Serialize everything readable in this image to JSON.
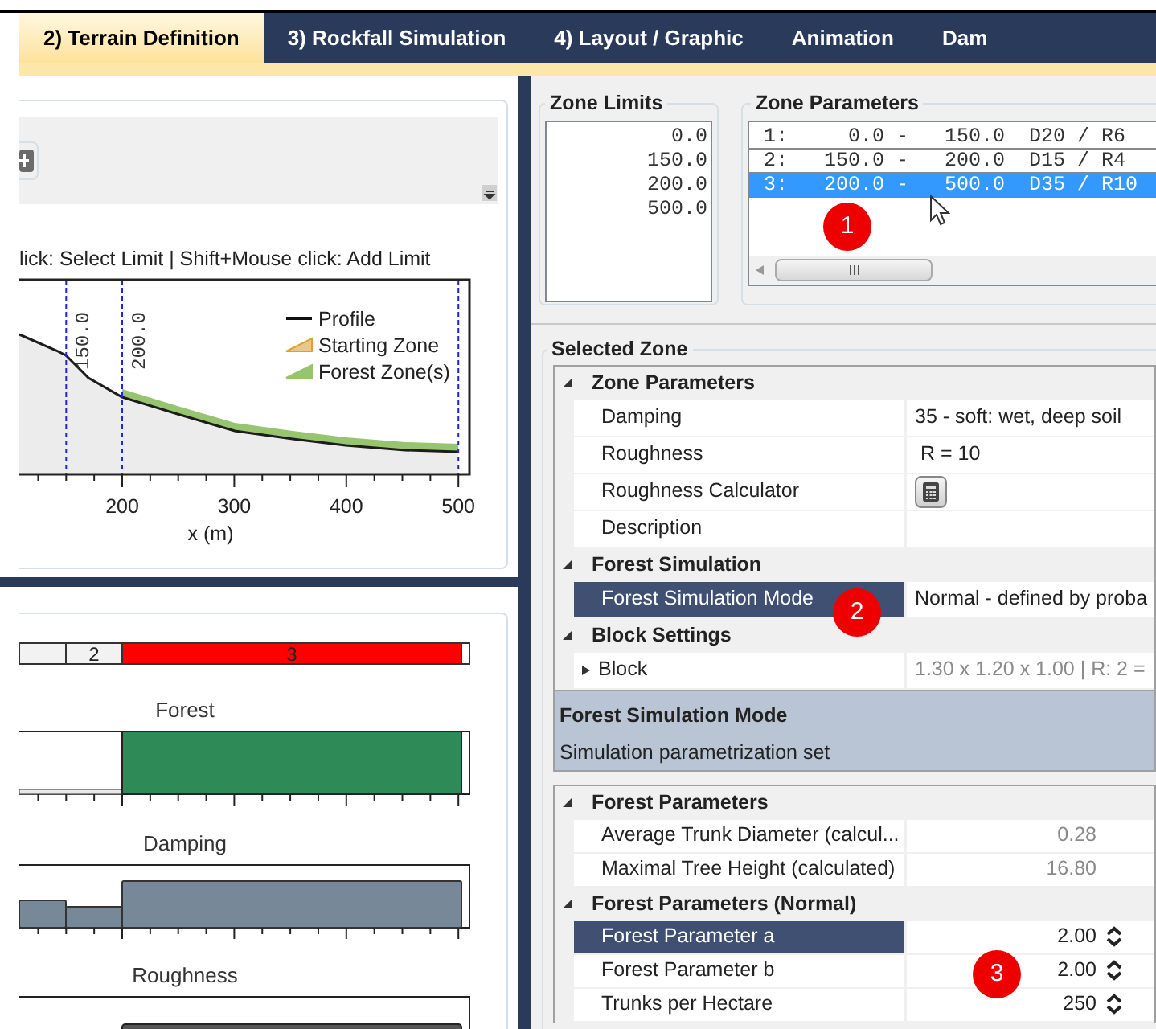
{
  "tabs": [
    {
      "label": "2) Terrain Definition",
      "selected": true
    },
    {
      "label": "3) Rockfall Simulation",
      "selected": false
    },
    {
      "label": "4) Layout / Graphic",
      "selected": false
    },
    {
      "label": "Animation",
      "selected": false
    },
    {
      "label": "Dam",
      "selected": false
    }
  ],
  "profile_chart": {
    "hint": "lick: Select Limit | Shift+Mouse click: Add Limit",
    "limit_labels": [
      "150.0",
      "200.0"
    ],
    "x_ticks": [
      "200",
      "300",
      "400",
      "500"
    ],
    "x_label": "x (m)",
    "legend": [
      {
        "label": "Profile",
        "kind": "line"
      },
      {
        "label": "Starting Zone",
        "kind": "start"
      },
      {
        "label": "Forest Zone(s)",
        "kind": "forest"
      }
    ]
  },
  "zone_strip": [
    {
      "label": "2",
      "selected": false
    },
    {
      "label": "3",
      "selected": true
    }
  ],
  "forest_chart": {
    "title": "Forest"
  },
  "damping_chart": {
    "title": "Damping"
  },
  "roughness_chart": {
    "title": "Roughness"
  },
  "zone_limits": {
    "title": "Zone Limits",
    "values": [
      "0.0",
      "150.0",
      "200.0",
      "500.0"
    ]
  },
  "zone_parameters": {
    "title": "Zone Parameters",
    "rows": [
      {
        "text": "1:     0.0 -   150.0  D20 / R6",
        "selected": false
      },
      {
        "text": "2:   150.0 -   200.0  D15 / R4",
        "selected": false
      },
      {
        "text": "3:   200.0 -   500.0  D35 / R10",
        "selected": true
      }
    ]
  },
  "selected_zone": {
    "title": "Selected Zone",
    "categories": [
      {
        "label": "Zone Parameters",
        "expanded": true,
        "properties": [
          {
            "name": "Damping",
            "kind": "text",
            "value": "35 - soft: wet, deep soil",
            "selected": false,
            "readonly": false
          },
          {
            "name": "Roughness",
            "kind": "text",
            "value": " R = 10",
            "selected": false,
            "readonly": false
          },
          {
            "name": "Roughness Calculator",
            "kind": "button",
            "selected": false
          },
          {
            "name": "Description",
            "kind": "text",
            "selected": false
          }
        ]
      },
      {
        "label": "Forest Simulation",
        "expanded": true,
        "properties": [
          {
            "name": "Forest Simulation Mode",
            "kind": "text",
            "value": "Normal - defined by proba",
            "selected": true,
            "readonly": false
          }
        ]
      },
      {
        "label": "Block Settings",
        "expanded": true,
        "properties": [
          {
            "name": "Block",
            "kind": "text",
            "value": "1.30 x 1.20 x 1.00 | R: 2 =",
            "selected": false,
            "readonly": true,
            "expanded": false
          }
        ]
      }
    ],
    "description": {
      "title": "Forest Simulation Mode",
      "text": "Simulation parametrization set"
    }
  },
  "forest_grid": {
    "categories": [
      {
        "label": "Forest Parameters",
        "expanded": true,
        "properties": [
          {
            "name": "Average Trunk Diameter (calcul...",
            "kind": "number",
            "value": "0.28",
            "selected": false,
            "readonly": true
          },
          {
            "name": "Maximal Tree Height (calculated)",
            "kind": "number",
            "value": "16.80",
            "selected": false,
            "readonly": true
          }
        ]
      },
      {
        "label": "Forest Parameters (Normal)",
        "expanded": true,
        "properties": [
          {
            "name": "Forest Parameter a",
            "kind": "spinner",
            "value": "2.00",
            "selected": true,
            "readonly": false
          },
          {
            "name": "Forest Parameter b",
            "kind": "spinner",
            "value": "2.00",
            "selected": false,
            "readonly": false
          },
          {
            "name": "Trunks per Hectare",
            "kind": "spinner",
            "value": "250",
            "selected": false,
            "readonly": false
          }
        ]
      }
    ]
  },
  "callouts": [
    {
      "label": "1"
    },
    {
      "label": "2"
    },
    {
      "label": "3"
    }
  ]
}
